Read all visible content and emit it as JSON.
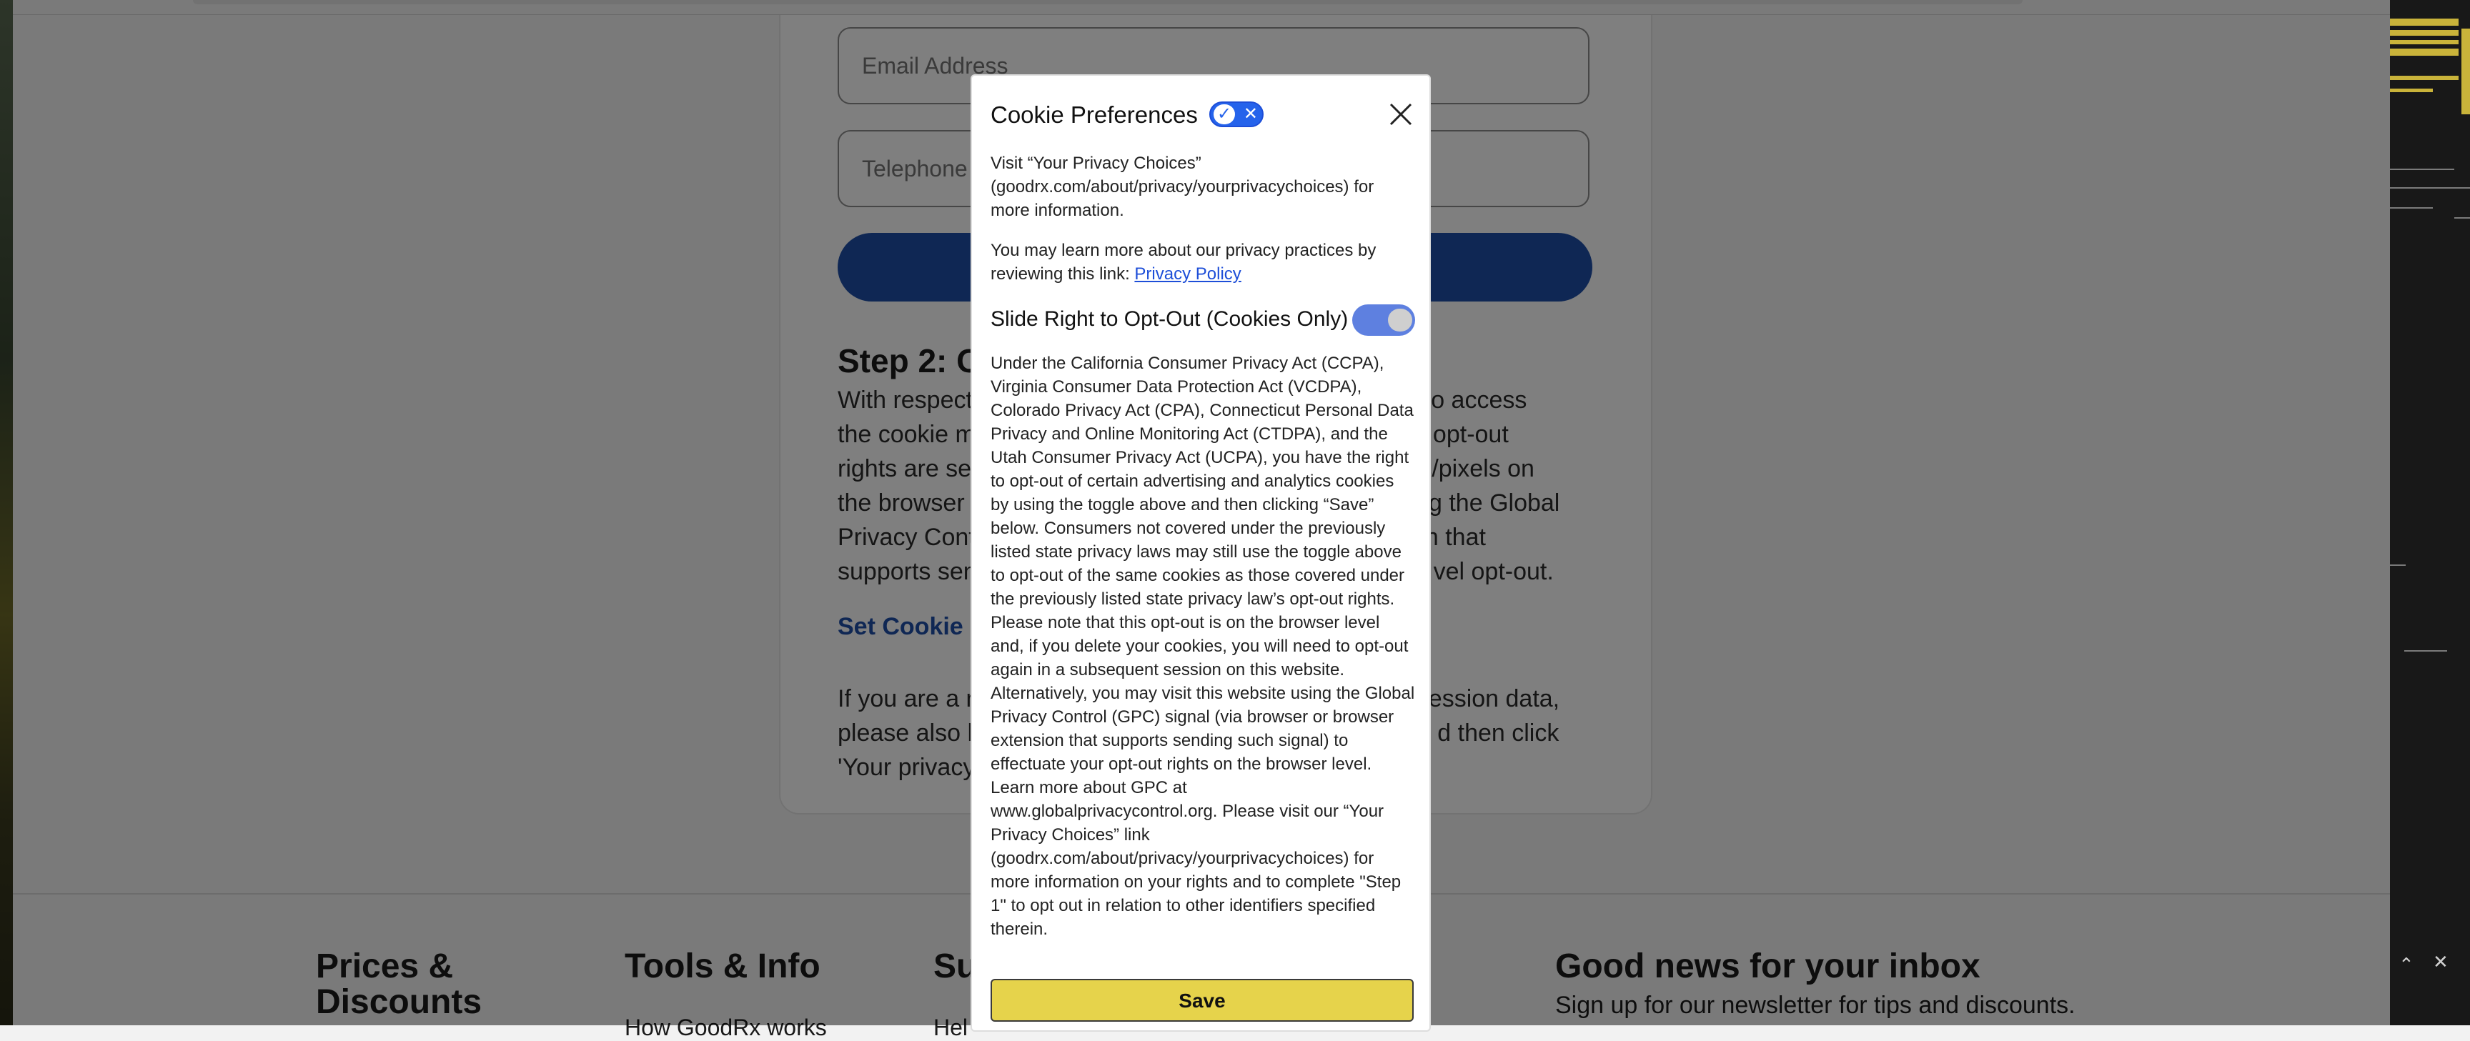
{
  "form": {
    "email_placeholder": "Email Address",
    "phone_placeholder": "Telephone N"
  },
  "step2": {
    "title": "Step 2: Op",
    "body_line1": "With respect to",
    "body_tail1": "w to access",
    "body_line2": "the cookie mo",
    "body_tail2": "such opt-out",
    "body_line3": "rights are set f",
    "body_tail3": "es/pixels on",
    "body_line4": "the browser lev",
    "body_tail4": "ing the Global",
    "body_line5": "Privacy Contro",
    "body_tail5": "on that",
    "body_line6": "supports send",
    "body_tail6": "vel opt-out.",
    "set_cookie_link": "Set Cookie Se",
    "mobile_line1": "If you are a mo",
    "mobile_tail1": "ession data,",
    "mobile_line2": "please also he",
    "mobile_tail2": "d then click",
    "mobile_line3": "'Your privacy c"
  },
  "footer": {
    "col1_title": "Prices & Discounts",
    "col2_title": "Tools & Info",
    "col2_link": "How GoodRx works",
    "col3_title": "Su",
    "col3_link": "Hel",
    "newsletter_title": "Good news for your inbox",
    "newsletter_sub": "Sign up for our newsletter for tips and discounts."
  },
  "modal": {
    "title": "Cookie Preferences",
    "visit_text": "Visit “Your Privacy Choices” (goodrx.com/about/privacy/yourprivacychoices) for more information.",
    "learn_text": "You may learn more about our privacy practices by reviewing this link: ",
    "privacy_link": "Privacy Policy",
    "optout_label": "Slide Right to Opt-Out (Cookies Only)",
    "optout_state": "on",
    "legal_text": "Under the California Consumer Privacy Act (CCPA), Virginia Consumer Data Protection Act (VCDPA), Colorado Privacy Act (CPA), Connecticut Personal Data Privacy and Online Monitoring Act (CTDPA), and the Utah Consumer Privacy Act (UCPA), you have the right to opt-out of certain advertising and analytics cookies by using the toggle above and then clicking “Save” below. Consumers not covered under the previously listed state privacy laws may still use the toggle above to opt-out of the same cookies as those covered under the previously listed state privacy law’s opt-out rights. Please note that this opt-out is on the browser level and, if you delete your cookies, you will need to opt-out again in a subsequent session on this website. Alternatively, you may visit this website using the Global Privacy Control (GPC) signal (via browser or browser extension that supports sending such signal) to effectuate your opt-out rights on the browser level. Learn more about GPC at www.globalprivacycontrol.org. Please visit our “Your Privacy Choices” link (goodrx.com/about/privacy/yourprivacychoices) for more information on your rights and to complete \"Step 1\" to opt out in relation to other identifiers specified therein.",
    "save_label": "Save"
  },
  "colors": {
    "primary_blue": "#1e4fa8",
    "save_yellow": "#e6d34b",
    "toggle_blue": "#5e80e0"
  },
  "icons": [
    "close-icon",
    "checkmark-icon",
    "x-icon",
    "chevron-up-icon"
  ]
}
